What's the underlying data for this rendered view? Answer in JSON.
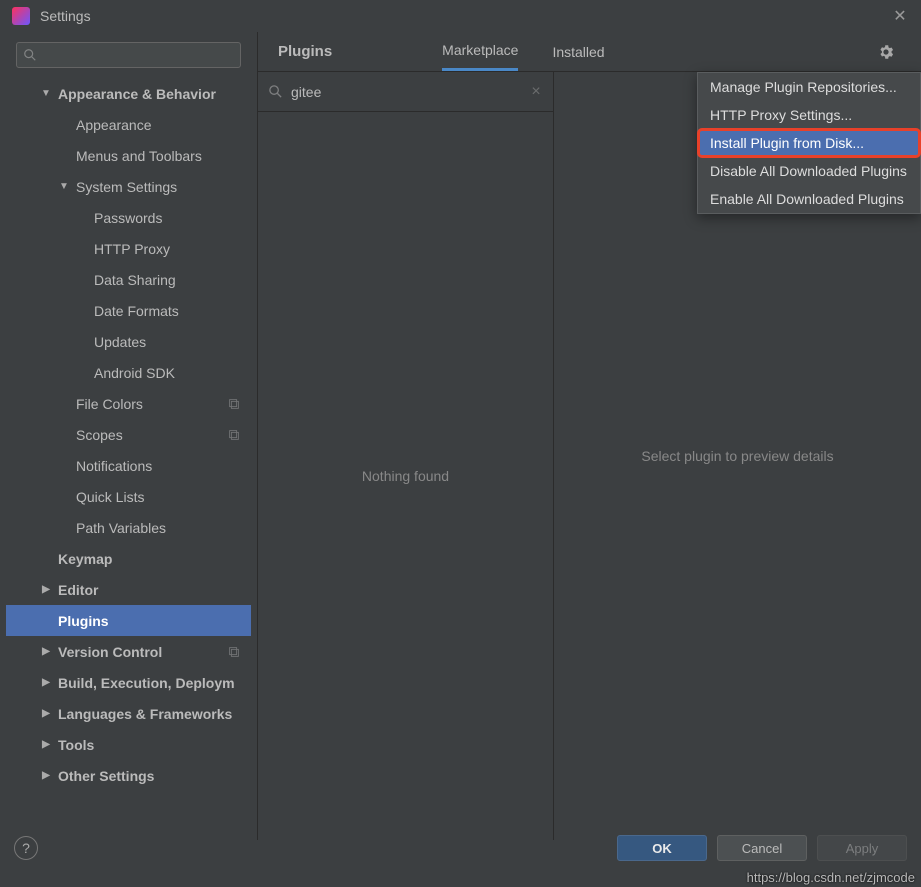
{
  "window": {
    "title": "Settings"
  },
  "sidebar": {
    "search_placeholder": "",
    "items": [
      {
        "label": "Appearance & Behavior",
        "depth": 1,
        "bold": true,
        "arrow": "down"
      },
      {
        "label": "Appearance",
        "depth": 2,
        "arrow": "none"
      },
      {
        "label": "Menus and Toolbars",
        "depth": 2,
        "arrow": "none"
      },
      {
        "label": "System Settings",
        "depth": 2,
        "arrow": "down"
      },
      {
        "label": "Passwords",
        "depth": 3,
        "arrow": "none"
      },
      {
        "label": "HTTP Proxy",
        "depth": 3,
        "arrow": "none"
      },
      {
        "label": "Data Sharing",
        "depth": 3,
        "arrow": "none"
      },
      {
        "label": "Date Formats",
        "depth": 3,
        "arrow": "none"
      },
      {
        "label": "Updates",
        "depth": 3,
        "arrow": "none"
      },
      {
        "label": "Android SDK",
        "depth": 3,
        "arrow": "none"
      },
      {
        "label": "File Colors",
        "depth": 2,
        "arrow": "none",
        "copy": true
      },
      {
        "label": "Scopes",
        "depth": 2,
        "arrow": "none",
        "copy": true
      },
      {
        "label": "Notifications",
        "depth": 2,
        "arrow": "none"
      },
      {
        "label": "Quick Lists",
        "depth": 2,
        "arrow": "none"
      },
      {
        "label": "Path Variables",
        "depth": 2,
        "arrow": "none"
      },
      {
        "label": "Keymap",
        "depth": 1,
        "bold": true,
        "arrow": "none"
      },
      {
        "label": "Editor",
        "depth": 1,
        "bold": true,
        "arrow": "right"
      },
      {
        "label": "Plugins",
        "depth": 1,
        "bold": true,
        "arrow": "none",
        "selected": true
      },
      {
        "label": "Version Control",
        "depth": 1,
        "bold": true,
        "arrow": "right",
        "copy": true
      },
      {
        "label": "Build, Execution, Deploym",
        "depth": 1,
        "bold": true,
        "arrow": "right"
      },
      {
        "label": "Languages & Frameworks",
        "depth": 1,
        "bold": true,
        "arrow": "right"
      },
      {
        "label": "Tools",
        "depth": 1,
        "bold": true,
        "arrow": "right"
      },
      {
        "label": "Other Settings",
        "depth": 1,
        "bold": true,
        "arrow": "right"
      }
    ]
  },
  "main": {
    "title": "Plugins",
    "tabs": {
      "marketplace": "Marketplace",
      "installed": "Installed"
    },
    "search_value": "gitee",
    "nothing": "Nothing found",
    "detail_placeholder": "Select plugin to preview details"
  },
  "dropdown": {
    "items": [
      "Manage Plugin Repositories...",
      "HTTP Proxy Settings...",
      "Install Plugin from Disk...",
      "Disable All Downloaded Plugins",
      "Enable All Downloaded Plugins"
    ],
    "highlighted_index": 2
  },
  "footer": {
    "ok": "OK",
    "cancel": "Cancel",
    "apply": "Apply"
  },
  "watermark": "https://blog.csdn.net/zjmcode"
}
